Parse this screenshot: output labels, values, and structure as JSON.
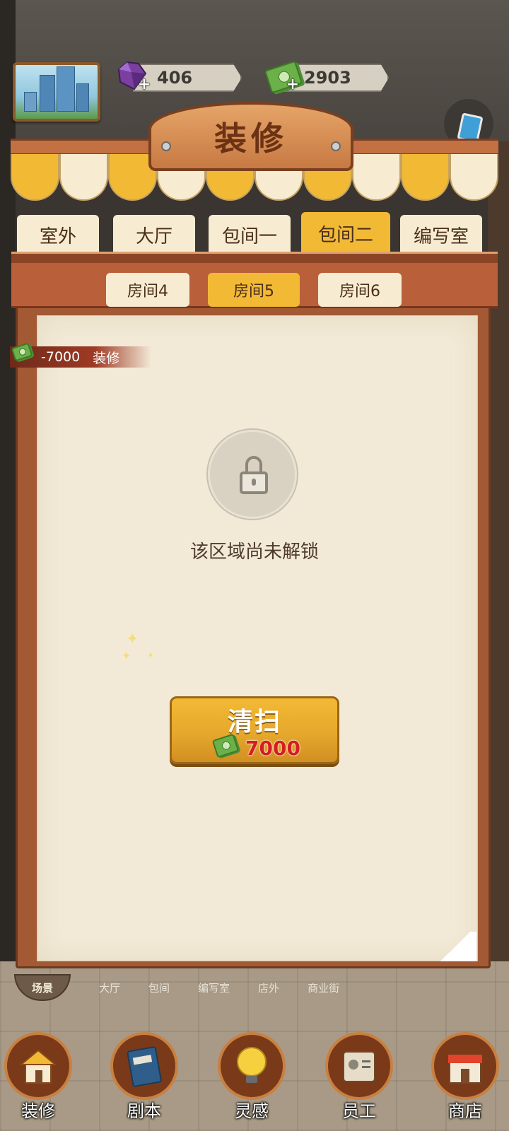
{
  "hud": {
    "gems": "406",
    "cash": "2903",
    "gem_color": "#7b3fa0",
    "cash_color": "#6cb04a"
  },
  "panel": {
    "title": "装修",
    "tabs": [
      {
        "label": "室外",
        "active": false
      },
      {
        "label": "大厅",
        "active": false
      },
      {
        "label": "包间一",
        "active": false
      },
      {
        "label": "包间二",
        "active": true
      },
      {
        "label": "编写室",
        "active": false
      }
    ],
    "subtabs": [
      {
        "label": "房间4",
        "active": false
      },
      {
        "label": "房间5",
        "active": true
      },
      {
        "label": "房间6",
        "active": false
      }
    ],
    "cost_flyout": {
      "amount": "-7000",
      "label": "装修"
    },
    "locked_message": "该区域尚未解锁",
    "clean_button": {
      "label": "清扫",
      "cost": "7000"
    }
  },
  "scene_strip": {
    "scene_button": "场景",
    "items": [
      "大厅",
      "包间",
      "编写室",
      "店外",
      "商业街"
    ]
  },
  "bottom_nav": [
    {
      "label": "装修",
      "icon": "house-icon"
    },
    {
      "label": "剧本",
      "icon": "script-book-icon"
    },
    {
      "label": "灵感",
      "icon": "lightbulb-icon"
    },
    {
      "label": "员工",
      "icon": "staff-badge-icon"
    },
    {
      "label": "商店",
      "icon": "shop-icon"
    }
  ],
  "colors": {
    "accent_yellow": "#f2b935",
    "cream": "#f7ecd1",
    "wood": "#a35a34",
    "cost_red": "#d61e1e"
  }
}
